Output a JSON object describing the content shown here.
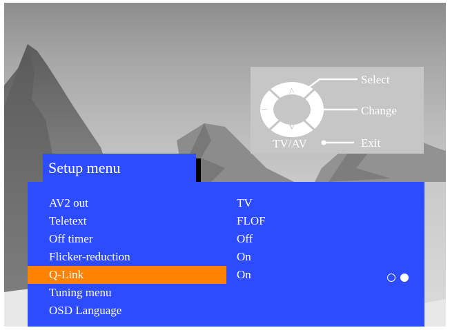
{
  "guide": {
    "select_label": "Select",
    "change_label": "Change",
    "exit_label": "Exit",
    "tvav_label": "TV/AV",
    "up_symbol": "^",
    "down_symbol": "v",
    "minus_symbol": "−",
    "plus_symbol": "+"
  },
  "title": "Setup menu",
  "menu": {
    "items": [
      {
        "name": "AV2 out",
        "value": "TV"
      },
      {
        "name": "Teletext",
        "value": "FLOF"
      },
      {
        "name": "Off timer",
        "value": "Off"
      },
      {
        "name": "Flicker-reduction",
        "value": "On"
      },
      {
        "name": "Q-Link",
        "value": "On"
      },
      {
        "name": "Tuning menu",
        "value": ""
      },
      {
        "name": "OSD Language",
        "value": ""
      }
    ],
    "selected_index": 4
  },
  "colors": {
    "menu_bg": "#2e4cff",
    "highlight": "#ff8200",
    "text": "#ffffff",
    "guide_bg": "#c6c6c6"
  }
}
